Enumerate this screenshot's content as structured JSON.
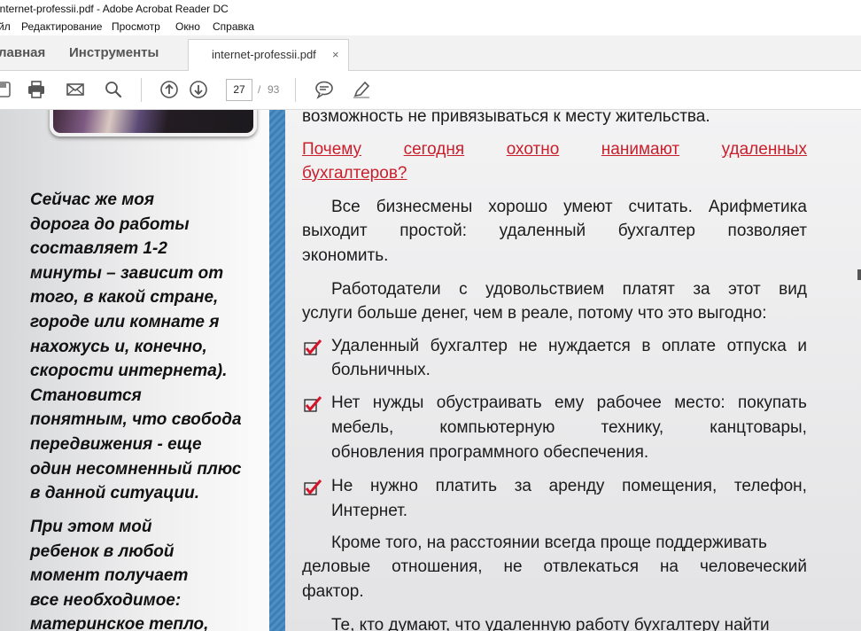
{
  "window": {
    "title": "internet-professii.pdf - Adobe Acrobat Reader DC"
  },
  "menu": [
    "йл",
    "Редактирование",
    "Просмотр",
    "Окно",
    "Справка"
  ],
  "tabs": {
    "home": "лавная",
    "tools": "Инструменты",
    "document": "internet-professii.pdf",
    "close_glyph": "×"
  },
  "toolbar": {
    "current_page": "27",
    "page_separator": "/",
    "total_pages": "93"
  },
  "left_text": {
    "para1": [
      "Сейчас же моя",
      "дорога до работы",
      "составляет 1-2",
      "минуты – зависит от",
      "того, в какой стране,",
      "городе или комнате я",
      "нахожусь и, конечно,",
      "скорости интернета).",
      "Становится",
      "понятным, что свобода",
      "передвижения -  еще",
      "один несомненный плюс",
      "в данной ситуации."
    ],
    "para2": [
      "При этом мой",
      "ребенок в любой",
      "момент получает",
      "все необходимое:",
      "материнское тепло,"
    ]
  },
  "main_text": {
    "line_top": "возможность не привязываться к месту жительства.",
    "heading": [
      "Почему сегодня охотно нанимают удаленных",
      "бухгалтеров?"
    ],
    "para1": [
      "Все бизнесмены хорошо умеют считать. Арифметика",
      "выходит простой: удаленный бухгалтер позволяет",
      "экономить."
    ],
    "para2": [
      "Работодатели с удовольствием платят за этот вид",
      "услуги больше денег, чем в реале, потому что это выгодно:"
    ],
    "bullet1": [
      "Удаленный бухгалтер не нуждается в оплате отпуска и",
      "больничных."
    ],
    "bullet2": [
      "Нет нужды обустраивать ему рабочее место: покупать",
      "мебель, компьютерную технику, канцтовары,",
      "обновления программного обеспечения."
    ],
    "bullet3": [
      "Не нужно платить за аренду помещения, телефон,",
      "Интернет."
    ],
    "para3": [
      "Кроме того, на расстоянии всегда проще поддерживать",
      "деловые отношения, не отвлекаться на человеческий",
      "фактор."
    ],
    "para4": [
      "Те, кто думают, что удаленную работу бухгалтеру найти"
    ]
  },
  "colors": {
    "heading_red": "#c91f2c",
    "accent_blue": "#4f8fc3",
    "check_red": "#d4142a"
  },
  "icons": [
    "save-icon",
    "print-icon",
    "email-icon",
    "search-icon",
    "page-up-icon",
    "page-down-icon",
    "comment-icon",
    "pen-icon"
  ]
}
